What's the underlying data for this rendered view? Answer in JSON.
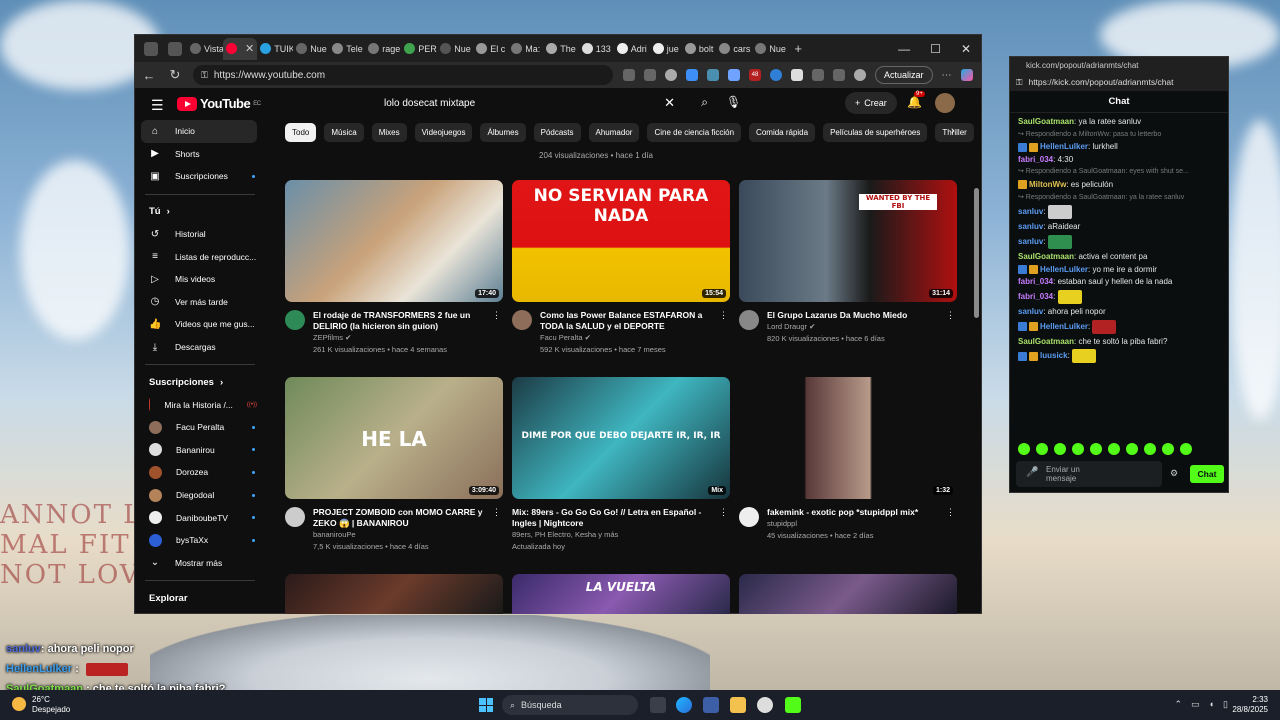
{
  "desktop": {
    "bg_text_lines": [
      "ANNOT LO  T GETRID OF THE PAI",
      "MAL  FIT  SETAL  LL  LOL  TONN",
      "NOT LOVE  T GETRID OF THE PA"
    ],
    "overlay_chat": [
      {
        "user": "sanluv",
        "text": ": ahora peli nopor"
      },
      {
        "user": "HellenLulker",
        "text": " : "
      },
      {
        "user": "SaulGoatmaan",
        "text": " : che te soltó la piba fabri?"
      }
    ]
  },
  "browser": {
    "tabs": [
      "Vista",
      "",
      "TUIK",
      "Nue",
      "Tele",
      "rage",
      "PER",
      "Nue",
      "El c",
      "Ma:",
      "The",
      "133",
      "Adri",
      "jue",
      "bolt",
      "cars",
      "Nue"
    ],
    "url": "https://www.youtube.com",
    "update_label": "Actualizar",
    "ext_badge": "48"
  },
  "yt": {
    "logo": "YouTube",
    "country": "EC",
    "search_query": "lolo dosecat mixtape",
    "create_label": "Crear",
    "bell_count": "9+",
    "sidebar_main": [
      {
        "icon": "⌂",
        "name": "home",
        "label": "Inicio"
      },
      {
        "icon": "▶",
        "name": "shorts",
        "label": "Shorts"
      },
      {
        "icon": "▣",
        "name": "subscriptions",
        "label": "Suscripciones"
      }
    ],
    "you_label": "Tú",
    "sidebar_you": [
      {
        "icon": "↺",
        "name": "history",
        "label": "Historial"
      },
      {
        "icon": "≡",
        "name": "playlists",
        "label": "Listas de reproducc..."
      },
      {
        "icon": "▷",
        "name": "my-videos",
        "label": "Mis videos"
      },
      {
        "icon": "◷",
        "name": "watch-later",
        "label": "Ver más tarde"
      },
      {
        "icon": "👍",
        "name": "liked",
        "label": "Videos que me gus..."
      },
      {
        "icon": "⤓",
        "name": "downloads",
        "label": "Descargas"
      }
    ],
    "subs_label": "Suscripciones",
    "subs": [
      {
        "label": "Mira la Historia /...",
        "live": true,
        "color": "#c0392b"
      },
      {
        "label": "Facu Peralta",
        "live": false,
        "color": "#8e6e5a"
      },
      {
        "label": "Bananirou",
        "live": false,
        "color": "#ddd"
      },
      {
        "label": "Dorozea",
        "live": false,
        "color": "#a0522d"
      },
      {
        "label": "Diegodoal",
        "live": false,
        "color": "#b5835a"
      },
      {
        "label": "DaniboubeTV",
        "live": false,
        "color": "#eee"
      },
      {
        "label": "bysTaXx",
        "live": false,
        "color": "#2c5fd6"
      }
    ],
    "show_more": "Mostrar más",
    "explore": "Explorar",
    "chips": [
      "Todo",
      "Música",
      "Mixes",
      "Videojuegos",
      "Álbumes",
      "Pódcasts",
      "Ahumador",
      "Cine de ciencia ficción",
      "Comida rápida",
      "Películas de superhéroes",
      "Thriller"
    ],
    "prev_meta": "204 visualizaciones • hace 1 día",
    "videos": [
      {
        "title": "El rodaje de TRANSFORMERS 2 fue un DELIRIO (la hicieron sin guion)",
        "channel": "ZEPfilms",
        "verified": true,
        "stats": "261 K visualizaciones • hace 4 semanas",
        "duration": "17:40",
        "thumb": "linear-gradient(135deg,#6a8fa8,#c9a27a 45%,#e9e4d8 70%,#5d7f93)",
        "av": "#2e8b57",
        "caption": ""
      },
      {
        "title": "Como las Power Balance ESTAFARON a TODA la SALUD y el DEPORTE",
        "channel": "Facu Peralta",
        "verified": true,
        "stats": "592 K visualizaciones • hace 7 meses",
        "duration": "15:54",
        "thumb": "linear-gradient(180deg,#e01515 0%,#d11 55%,#f2c200 56%,#e8b800 100%)",
        "av": "#8e6e5a",
        "caption": "NO SERVIAN PARA NADA"
      },
      {
        "title": "El Grupo Lazarus Da Mucho Miedo",
        "channel": "Lord Draugr",
        "verified": true,
        "stats": "820 K visualizaciones • hace 6 días",
        "duration": "31:14",
        "thumb": "linear-gradient(90deg,#3a4a5a 0%,#6b7a86 40%,#1a1a1a 60%,#b01010 100%)",
        "av": "#888",
        "caption": "WANTED BY THE FBI"
      },
      {
        "title": "PROJECT ZOMBOID con MOMO CARRE y ZEKO 😱 | BANANIROU",
        "channel": "bananirouPe",
        "verified": false,
        "stats": "7,5 K visualizaciones • hace 4 días",
        "duration": "3:09:40",
        "thumb": "linear-gradient(135deg,#6f8a5a,#b9b08a 50%,#8a6f5a)",
        "av": "#ccc",
        "caption": "HE LA"
      },
      {
        "title": "Mix: 89ers - Go Go Go Go! // Letra en Español - Ingles | Nightcore",
        "channel": "89ers, PH Electro, Kesha y más",
        "verified": false,
        "stats": "Actualizada hoy",
        "duration": "Mix",
        "thumb": "linear-gradient(135deg,#1c3b45,#3fb6c0 50%,#17343c)",
        "av": "",
        "caption": "DIME POR QUE DEBO DEJARTE IR, IR, IR"
      },
      {
        "title": "fakemink - exotic pop *stupidppl mix*",
        "channel": "stupidppl",
        "verified": false,
        "stats": "45 visualizaciones • hace 2 días",
        "duration": "1:32",
        "thumb": "linear-gradient(90deg,#0f0f0f 0%,#0f0f0f 30%,#5a3a3a 31%,#b89a8a 60%,#0f0f0f 61%)",
        "av": "#eee",
        "caption": ""
      }
    ],
    "row3_captions": [
      "",
      "LA VUELTA",
      ""
    ]
  },
  "kick": {
    "title": "kick.com/popout/adrianmts/chat",
    "url": "https://kick.com/popout/adrianmts/chat",
    "header": "Chat",
    "messages": [
      {
        "reply": "",
        "user": "SaulGoatmaan",
        "cls": "k-name-g",
        "badges": 0,
        "text": ": ya la ratee sanluv"
      },
      {
        "reply": "↪ Respondiendo a MiltonWw: pasa tu letterbo",
        "user": "HellenLulker",
        "cls": "k-name-b",
        "badges": 2,
        "text": ": lurkhell"
      },
      {
        "reply": "",
        "user": "fabri_034",
        "cls": "k-name-p",
        "badges": 0,
        "text": ": 4:30"
      },
      {
        "reply": "↪ Respondiendo a SaulGoatmaan: eyes with shut se...",
        "user": "MiltonWw",
        "cls": "k-name-y",
        "badges": 1,
        "text": ": es peliculón"
      },
      {
        "reply": "↪ Respondiendo a SaulGoatmaan: ya la ratee sanluv",
        "user": "sanluv",
        "cls": "k-name-b",
        "badges": 0,
        "text": ": ",
        "emote": "#ccc"
      },
      {
        "reply": "",
        "user": "sanluv",
        "cls": "k-name-b",
        "badges": 0,
        "text": ": aRaidear"
      },
      {
        "reply": "",
        "user": "sanluv",
        "cls": "k-name-b",
        "badges": 0,
        "text": ": ",
        "emote": "#2f8f4f"
      },
      {
        "reply": "",
        "user": "SaulGoatmaan",
        "cls": "k-name-g",
        "badges": 0,
        "text": ": activa el content pa"
      },
      {
        "reply": "",
        "user": "HellenLulker",
        "cls": "k-name-b",
        "badges": 2,
        "text": ": yo me ire a dormir"
      },
      {
        "reply": "",
        "user": "fabri_034",
        "cls": "k-name-p",
        "badges": 0,
        "text": ": estaban saul y hellen de la nada"
      },
      {
        "reply": "",
        "user": "fabri_034",
        "cls": "k-name-p",
        "badges": 0,
        "text": ": ",
        "emote": "#e8d020"
      },
      {
        "reply": "",
        "user": "sanluv",
        "cls": "k-name-b",
        "badges": 0,
        "text": ": ahora peli nopor"
      },
      {
        "reply": "",
        "user": "HellenLulker",
        "cls": "k-name-b",
        "badges": 2,
        "text": ": ",
        "emote": "#b22222"
      },
      {
        "reply": "",
        "user": "SaulGoatmaan",
        "cls": "k-name-g",
        "badges": 0,
        "text": ": che te soltó la piba fabri?"
      },
      {
        "reply": "",
        "user": "luusick",
        "cls": "k-name-b",
        "badges": 2,
        "text": ": ",
        "emote": "#e8d020"
      }
    ],
    "input_placeholder": "Enviar un mensaje",
    "send_label": "Chat"
  },
  "taskbar": {
    "temp": "26°C",
    "weather": "Despejado",
    "search": "Búsqueda",
    "time": "2:33",
    "date": "28/8/2025"
  }
}
